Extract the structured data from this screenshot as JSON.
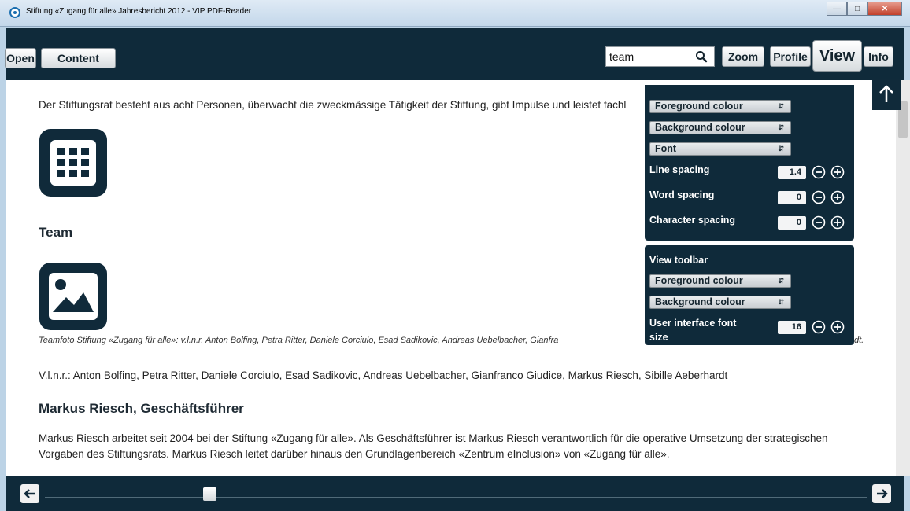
{
  "window": {
    "title": "Stiftung «Zugang für alle» Jahresbericht 2012 - VIP PDF-Reader"
  },
  "toolbar": {
    "open": "Open",
    "content": "Content",
    "search_value": "team",
    "zoom": "Zoom",
    "profile": "Profile",
    "view": "View",
    "info": "Info"
  },
  "document": {
    "intro": "Der Stiftungsrat besteht aus acht Personen, überwacht die zweckmässige Tätigkeit der Stiftung, gibt Impulse und leistet fachl",
    "team_heading": "Team",
    "caption": "Teamfoto Stiftung «Zugang für alle»: v.l.n.r. Anton Bolfing, Petra Ritter, Daniele Corciulo, Esad Sadikovic, Andreas Uebelbacher, Gianfra",
    "caption_tail": "dt.",
    "names": "V.l.n.r.: Anton Bolfing, Petra Ritter, Daniele Corciulo, Esad Sadikovic, Andreas Uebelbacher, Gianfranco Giudice, Markus Riesch, Sibille Aeberhardt",
    "markus_heading": "Markus Riesch, Geschäftsführer",
    "markus_line1": "Markus Riesch arbeitet seit 2004 bei der Stiftung «Zugang für alle». Als Geschäftsführer ist Markus Riesch verantwortlich für die operative Umsetzung der strategischen",
    "markus_line2": "Vorgaben des Stiftungsrats. Markus Riesch leitet darüber hinaus den Grundlagenbereich «Zentrum eInclusion» von «Zugang für alle»."
  },
  "view_menu": {
    "foreground": "Foreground colour",
    "background": "Background colour",
    "font": "Font",
    "line_spacing": {
      "label": "Line spacing",
      "value": "1.4"
    },
    "word_spacing": {
      "label": "Word spacing",
      "value": "0"
    },
    "char_spacing": {
      "label": "Character spacing",
      "value": "0"
    },
    "toolbar_section": "View toolbar",
    "tb_foreground": "Foreground colour",
    "tb_background": "Background colour",
    "ui_font_label_1": "User interface font",
    "ui_font_label_2": "size",
    "ui_font_value": "16"
  },
  "navigation": {
    "page_position": 0.2
  },
  "icons": [
    "apps-grid-icon",
    "image-icon",
    "search-icon",
    "arrow-up-icon",
    "arrow-left-icon",
    "arrow-right-icon",
    "minus-circle-icon",
    "plus-circle-icon"
  ]
}
